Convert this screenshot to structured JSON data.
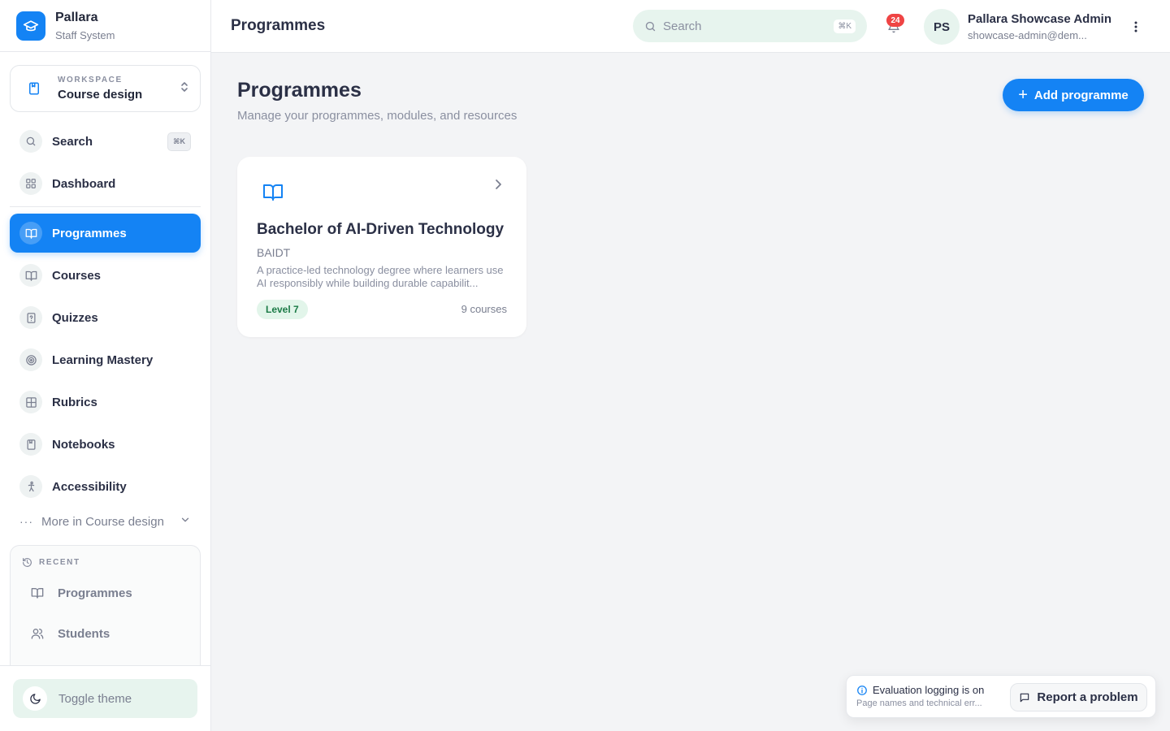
{
  "brand": {
    "name": "Pallara",
    "subtitle": "Staff System",
    "logo_icon": "graduation-cap-icon",
    "color": "#1483f4"
  },
  "workspace": {
    "label": "WORKSPACE",
    "name": "Course design",
    "icon": "notebook-icon"
  },
  "sidebar": {
    "search": {
      "label": "Search",
      "shortcut": "⌘K"
    },
    "dashboard": {
      "label": "Dashboard"
    },
    "items": [
      {
        "label": "Programmes",
        "icon": "book-open-icon",
        "active": true
      },
      {
        "label": "Courses",
        "icon": "book-open-icon"
      },
      {
        "label": "Quizzes",
        "icon": "file-question-icon"
      },
      {
        "label": "Learning Mastery",
        "icon": "target-icon"
      },
      {
        "label": "Rubrics",
        "icon": "grid-check-icon"
      },
      {
        "label": "Notebooks",
        "icon": "notebook-icon"
      },
      {
        "label": "Accessibility",
        "icon": "accessibility-icon"
      }
    ],
    "more": {
      "label": "More in Course design"
    },
    "recent": {
      "label": "RECENT",
      "items": [
        {
          "label": "Programmes",
          "icon": "book-open-icon"
        },
        {
          "label": "Students",
          "icon": "users-icon"
        }
      ]
    },
    "theme": {
      "label": "Toggle theme"
    }
  },
  "header": {
    "title": "Programmes",
    "search": {
      "placeholder": "Search",
      "shortcut": "⌘K"
    },
    "notifications": {
      "count": "24"
    },
    "user": {
      "initials": "PS",
      "name": "Pallara Showcase Admin",
      "email": "showcase-admin@dem..."
    }
  },
  "main": {
    "title": "Programmes",
    "subtitle": "Manage your programmes, modules, and resources",
    "add_button": "Add programme",
    "programmes": [
      {
        "title": "Bachelor of AI-Driven Technology",
        "code": "BAIDT",
        "description": "A practice-led technology degree where learners use AI responsibly while building durable capabilit...",
        "level": "Level 7",
        "courses": "9 courses"
      }
    ]
  },
  "toast": {
    "title": "Evaluation logging is on",
    "subtitle": "Page names and technical err...",
    "button": "Report a problem"
  },
  "colors": {
    "accent": "#1483f4",
    "mint": "#e7f4ee",
    "badge": "#ef4444",
    "level_bg": "#e2f5ea",
    "level_text": "#1b7a46"
  }
}
